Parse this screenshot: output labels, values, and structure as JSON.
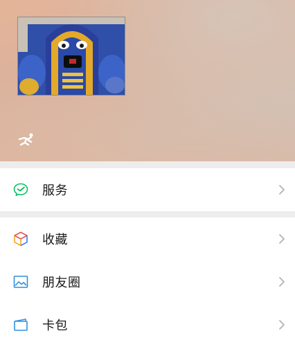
{
  "profile": {
    "avatar_icon": "cobra-robot-avatar",
    "status_icon": "running-person-icon"
  },
  "menu": {
    "services": {
      "label": "服务",
      "icon": "wechat-pay-icon"
    },
    "favorites": {
      "label": "收藏",
      "icon": "cube-icon"
    },
    "moments": {
      "label": "朋友圈",
      "icon": "picture-icon"
    },
    "cards": {
      "label": "卡包",
      "icon": "card-icon"
    }
  },
  "colors": {
    "page_bg": "#ededed",
    "header_warm": "#e4b498",
    "green": "#07c160",
    "blue": "#2f8fe0",
    "chevron": "#b2b2b2"
  }
}
